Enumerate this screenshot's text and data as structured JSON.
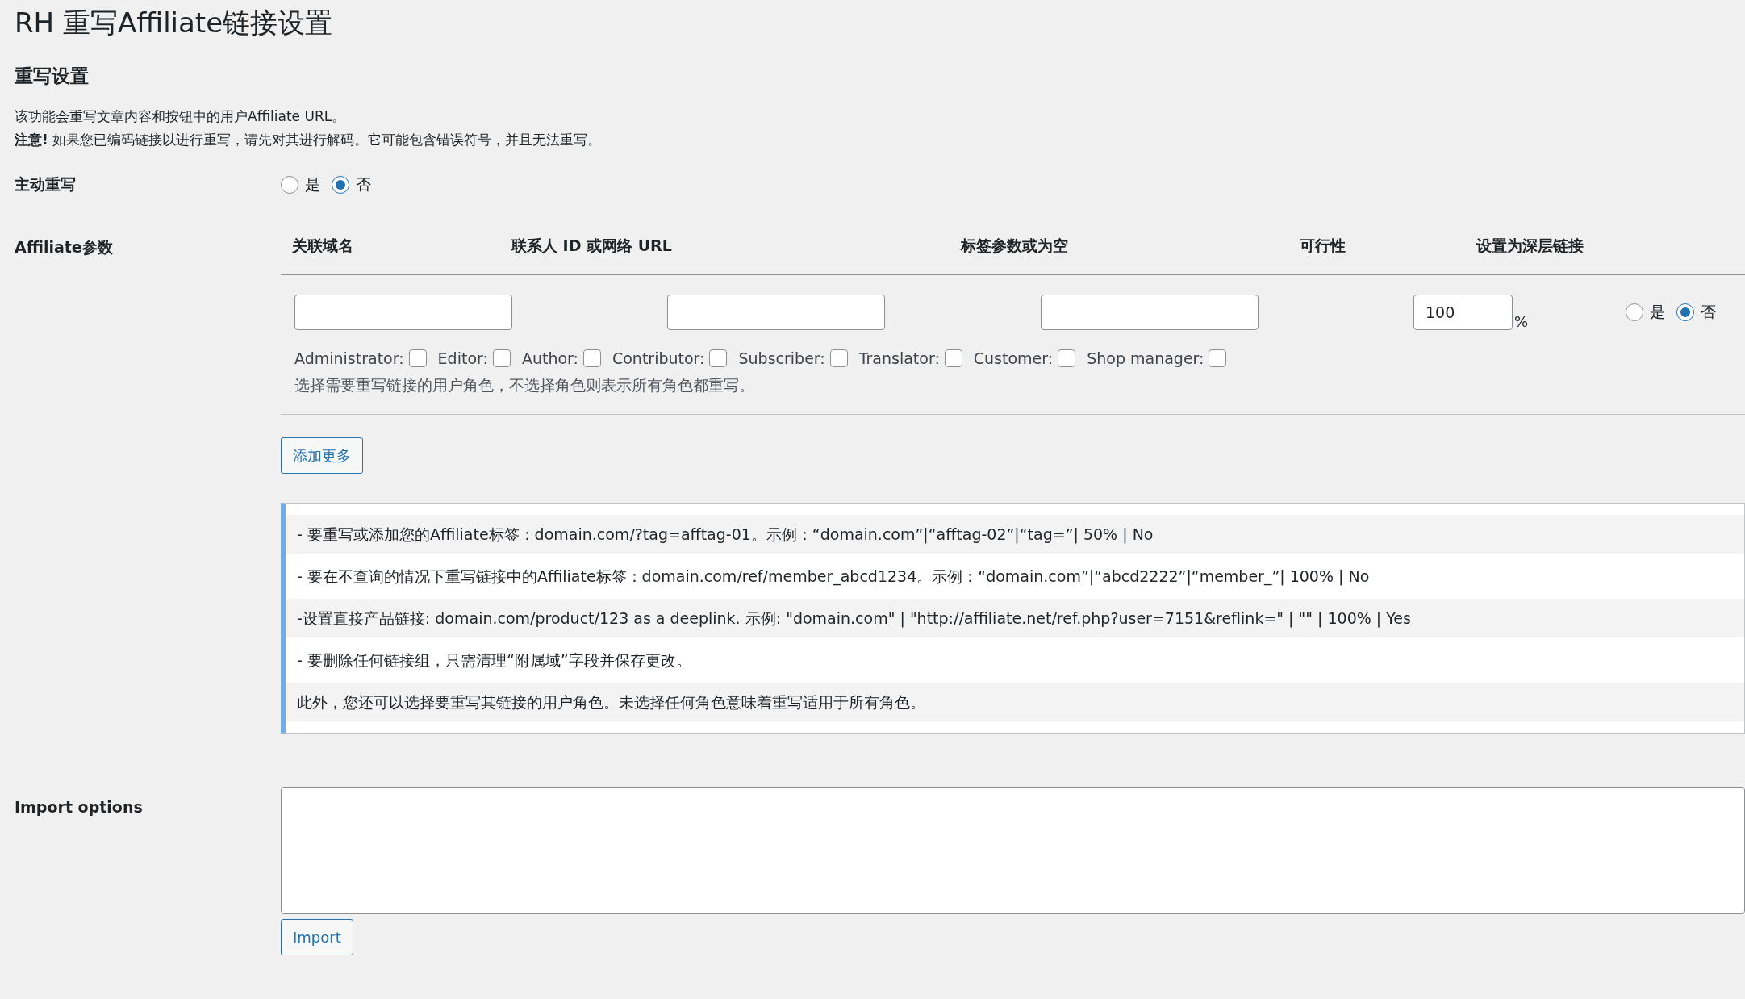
{
  "page_title": "RH 重写Affiliate链接设置",
  "section_title": "重写设置",
  "description": "该功能会重写文章内容和按钮中的用户Affiliate URL。",
  "notice": "**注意!** 如果您已编码链接以进行重写，请先对其进行解码。它可能包含错误符号，并且无法重写。",
  "active_rewrite": {
    "label": "主动重写",
    "options": [
      {
        "label": "是",
        "selected": false
      },
      {
        "label": "否",
        "selected": true
      }
    ]
  },
  "affiliate": {
    "label": "Affiliate参数",
    "columns": [
      "关联域名",
      "联系人 ID 或网络 URL",
      "标签参数或为空",
      "可行性",
      "设置为深层链接"
    ],
    "rows": [
      {
        "feasibility": "100",
        "unit": "%",
        "deeplink_options": [
          {
            "label": "是",
            "selected": false
          },
          {
            "label": "否",
            "selected": true
          }
        ],
        "roles": [
          {
            "label": "Administrator:",
            "checked": false
          },
          {
            "label": "Editor:",
            "checked": false
          },
          {
            "label": "Author:",
            "checked": false
          },
          {
            "label": "Contributor:",
            "checked": false
          },
          {
            "label": "Subscriber:",
            "checked": false
          },
          {
            "label": "Translator:",
            "checked": false
          },
          {
            "label": "Customer:",
            "checked": false
          },
          {
            "label": "Shop manager:",
            "checked": false
          }
        ],
        "roles_hint": "选择需要重写链接的用户角色，不选择角色则表示所有角色都重写。"
      }
    ],
    "add_button": "添加更多"
  },
  "info_lines": [
    "- 要重写或添加您的Affiliate标签：domain.com/?tag=afftag-01。示例：“domain.com”|“afftag-02”|“tag=”| 50% | No",
    "- 要在不查询的情况下重写链接中的Affiliate标签：domain.com/ref/member_abcd1234。示例：“domain.com”|“abcd2222”|“member_”| 100% | No",
    "-设置直接产品链接: domain.com/product/123 as a deeplink. 示例: \"domain.com\" | \"http://affiliate.net/ref.php?user=7151&reflink=\" | \"\" | 100% | Yes",
    "- 要删除任何链接组，只需清理“附属域”字段并保存更改。",
    "此外，您还可以选择要重写其链接的用户角色。未选择任何角色意味着重写适用于所有角色。"
  ],
  "import": {
    "label": "Import options",
    "button": "Import"
  }
}
